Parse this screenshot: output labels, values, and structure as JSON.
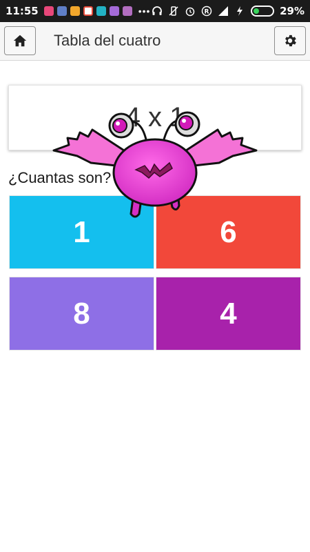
{
  "status_bar": {
    "time": "11:55",
    "more_indicator": "•••",
    "battery_percent": "29%",
    "battery_level": 0.29,
    "notification_colors": [
      "#e8477a",
      "#5f7fc8",
      "#f2a72c",
      "#e44a3a",
      "#22b2c4",
      "#a46ad8",
      "#b26ec0"
    ],
    "icons": [
      "headphones-icon",
      "vibrate-off-icon",
      "alarm-icon",
      "registered-icon",
      "signal-icon",
      "charging-icon",
      "battery-icon"
    ]
  },
  "app_bar": {
    "title": "Tabla del cuatro",
    "home_icon": "home-icon",
    "settings_icon": "gear-icon"
  },
  "question": {
    "text": "4 x 1"
  },
  "prompt": "¿Cuantas son?",
  "answers": [
    {
      "label": "1",
      "color": "#14bfee"
    },
    {
      "label": "6",
      "color": "#f2483a"
    },
    {
      "label": "8",
      "color": "#8e6fe6"
    },
    {
      "label": "4",
      "color": "#a822ab"
    }
  ],
  "monster": {
    "icon": "flying-monster-icon",
    "body_color": "#e43ad0"
  }
}
